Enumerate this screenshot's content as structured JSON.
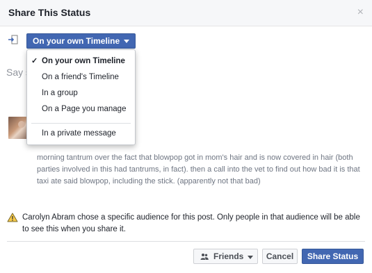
{
  "dialog": {
    "title": "Share This Status",
    "close_glyph": "×"
  },
  "share_row": {
    "icon": "share-arrow-icon",
    "audience_button_label": "On your own Timeline"
  },
  "composer": {
    "placeholder_visible": "Say s"
  },
  "dropdown": {
    "options": [
      {
        "label": "On your own Timeline",
        "selected": true
      },
      {
        "label": "On a friend's Timeline",
        "selected": false
      },
      {
        "label": "In a group",
        "selected": false
      },
      {
        "label": "On a Page you manage",
        "selected": false
      },
      {
        "label": "In a private message",
        "selected": false
      }
    ],
    "check_glyph": "✓"
  },
  "post": {
    "text": "morning tantrum over the fact that blowpop got in mom's hair and is now covered in hair (both parties involved in this had tantrums, in fact). then a call into the vet to find out how bad it is that taxi ate said blowpop, including the stick. (apparently not that bad)"
  },
  "warning": {
    "icon": "warning-triangle-icon",
    "text": "Carolyn Abram chose a specific audience for this post. Only people in that audience will be able to see this when you share it."
  },
  "footer": {
    "friends_label": "Friends",
    "cancel_label": "Cancel",
    "share_label": "Share Status"
  },
  "colors": {
    "primary": "#4267b2",
    "header_bg": "#f6f7f9",
    "warning_yellow": "#f7c948"
  }
}
